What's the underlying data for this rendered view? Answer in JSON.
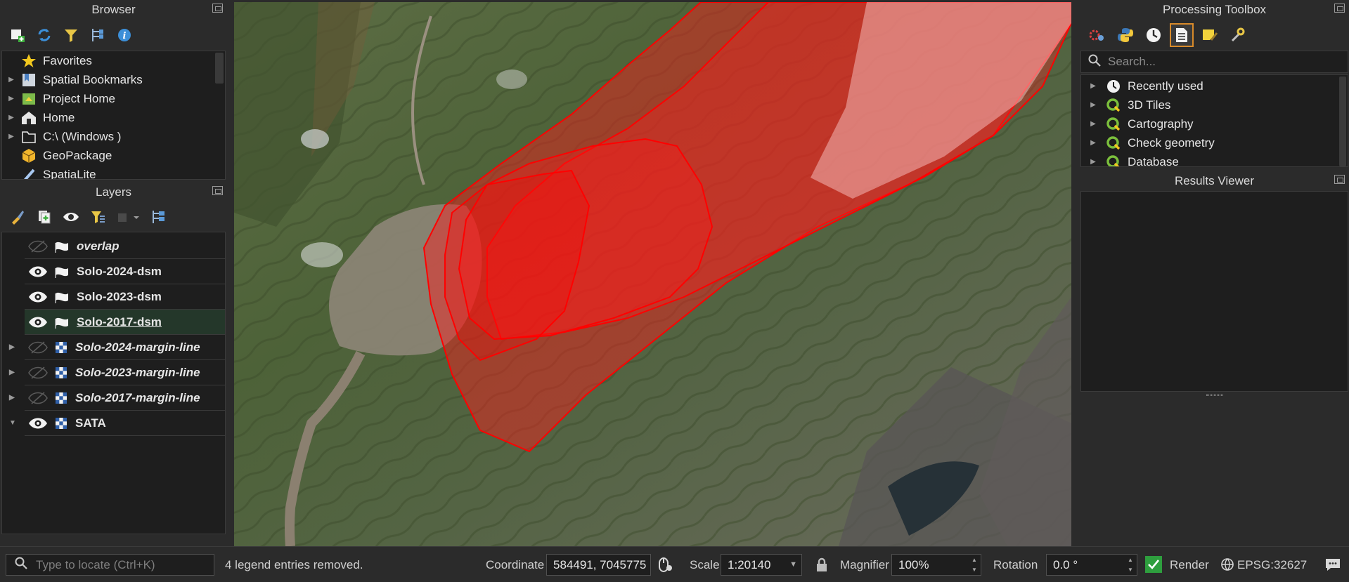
{
  "browser": {
    "title": "Browser",
    "toolbar_icons": [
      "add-layer-icon",
      "refresh-icon",
      "filter-icon",
      "collapse-all-icon",
      "info-icon"
    ],
    "items": [
      {
        "label": "Favorites",
        "icon": "star-icon",
        "expandable": false
      },
      {
        "label": "Spatial Bookmarks",
        "icon": "bookmark-icon",
        "expandable": true
      },
      {
        "label": "Project Home",
        "icon": "project-home-icon",
        "expandable": true
      },
      {
        "label": "Home",
        "icon": "home-icon",
        "expandable": true
      },
      {
        "label": "C:\\ (Windows )",
        "icon": "folder-icon",
        "expandable": true
      },
      {
        "label": "GeoPackage",
        "icon": "geopackage-icon",
        "expandable": false
      },
      {
        "label": "SpatiaLite",
        "icon": "spatialite-icon",
        "expandable": false
      }
    ]
  },
  "layers": {
    "title": "Layers",
    "toolbar_icons": [
      "style-icon",
      "add-group-icon",
      "visibility-icon",
      "filter-legend-icon",
      "remove-layer-icon",
      "expand-all-icon"
    ],
    "items": [
      {
        "label": "overlap",
        "visible": false,
        "type": "polygon",
        "italic": true,
        "expandable": false,
        "selected": false
      },
      {
        "label": "Solo-2024-dsm",
        "visible": true,
        "type": "polygon",
        "italic": false,
        "expandable": false,
        "selected": false
      },
      {
        "label": "Solo-2023-dsm",
        "visible": true,
        "type": "polygon",
        "italic": false,
        "expandable": false,
        "selected": false
      },
      {
        "label": "Solo-2017-dsm",
        "visible": true,
        "type": "polygon",
        "italic": false,
        "expandable": false,
        "selected": true
      },
      {
        "label": "Solo-2024-margin-line",
        "visible": false,
        "type": "raster",
        "italic": true,
        "expandable": true,
        "selected": false
      },
      {
        "label": "Solo-2023-margin-line",
        "visible": false,
        "type": "raster",
        "italic": true,
        "expandable": true,
        "selected": false
      },
      {
        "label": "Solo-2017-margin-line",
        "visible": false,
        "type": "raster",
        "italic": true,
        "expandable": true,
        "selected": false
      },
      {
        "label": "SATA",
        "visible": true,
        "type": "raster",
        "italic": false,
        "expandable": true,
        "expanded": true,
        "selected": false
      }
    ]
  },
  "toolbox": {
    "title": "Processing Toolbox",
    "toolbar_icons": [
      "models-icon",
      "python-icon",
      "history-icon",
      "results-icon",
      "edit-features-icon",
      "options-icon"
    ],
    "search_placeholder": "Search...",
    "items": [
      {
        "label": "Recently used",
        "icon": "clock-icon"
      },
      {
        "label": "3D Tiles",
        "icon": "qgis-icon"
      },
      {
        "label": "Cartography",
        "icon": "qgis-icon"
      },
      {
        "label": "Check geometry",
        "icon": "qgis-icon"
      },
      {
        "label": "Database",
        "icon": "qgis-icon"
      }
    ]
  },
  "results": {
    "title": "Results Viewer"
  },
  "status": {
    "locator_placeholder": "Type to locate (Ctrl+K)",
    "message": "4 legend entries removed.",
    "coordinate_label": "Coordinate",
    "coordinate_value": "584491, 7045775",
    "scale_label": "Scale",
    "scale_value": "1:20140",
    "magnifier_label": "Magnifier",
    "magnifier_value": "100%",
    "rotation_label": "Rotation",
    "rotation_value": "0.0 °",
    "render_label": "Render",
    "render_checked": true,
    "crs": "EPSG:32627"
  },
  "colors": {
    "polygon_fill": "#ff1a1a",
    "polygon_stroke": "#ff0000",
    "panel_bg": "#2b2b2b",
    "tree_bg": "#1e1e1e",
    "check_green": "#2e9e3e"
  }
}
